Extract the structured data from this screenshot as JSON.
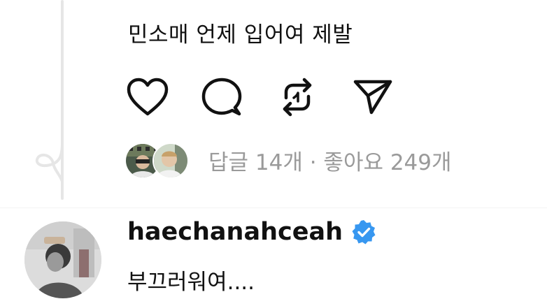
{
  "post": {
    "text": "민소매 언제 입어여 제발"
  },
  "actions": {
    "like_icon": "heart-icon",
    "comment_icon": "comment-icon",
    "repost_icon": "repost-icon",
    "share_icon": "send-icon"
  },
  "stats": {
    "text": "답글 14개 · 좋아요 249개"
  },
  "reply": {
    "username": "haechanahceah",
    "verified_icon": "verified-badge-icon",
    "text": "부끄러워여....",
    "verified_color": "#3797f0"
  }
}
